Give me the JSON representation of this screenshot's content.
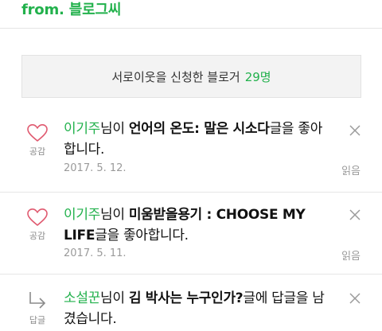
{
  "header": {
    "title": "from. 블로그씨"
  },
  "banner": {
    "text": "서로이웃을 신청한 블로거",
    "count": "29명"
  },
  "notifications": [
    {
      "action_label": "공감",
      "icon": "heart-icon",
      "user": "이기주",
      "particle": "님이 ",
      "post": "언어의 온도: 말은 시소다",
      "suffix": "글을 좋아합니다.",
      "date": "2017. 5. 12.",
      "status": "읽음"
    },
    {
      "action_label": "공감",
      "icon": "heart-icon",
      "user": "이기주",
      "particle": "님이 ",
      "post": "미움받을용기 : CHOOSE MY LIFE",
      "suffix": "글을 좋아합니다.",
      "date": "2017. 5. 11.",
      "status": "읽음"
    },
    {
      "action_label": "답글",
      "icon": "reply-arrow-icon",
      "user": "소설꾼",
      "particle": "님이 ",
      "post": "김 박사는 누구인가?",
      "suffix": "글에 답글을 남겼습니다.",
      "date": "",
      "status": ""
    }
  ],
  "colors": {
    "accent": "#22b14c",
    "muted": "#9a9a9a",
    "banner_bg": "#f3f3f3"
  }
}
